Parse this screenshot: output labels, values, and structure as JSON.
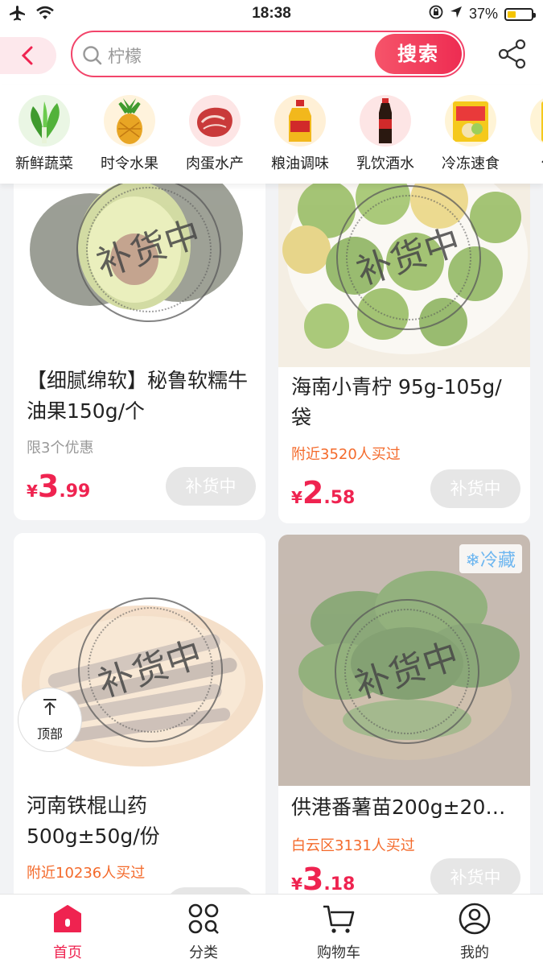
{
  "status_bar": {
    "time": "18:38",
    "battery": "37%"
  },
  "header": {
    "search_placeholder": "柠檬",
    "search_button": "搜索"
  },
  "categories": [
    {
      "label": "新鲜蔬菜",
      "icon": "vegetable-icon"
    },
    {
      "label": "时令水果",
      "icon": "pineapple-icon"
    },
    {
      "label": "肉蛋水产",
      "icon": "meat-icon"
    },
    {
      "label": "粮油调味",
      "icon": "oil-bottle-icon"
    },
    {
      "label": "乳饮酒水",
      "icon": "cola-bottle-icon"
    },
    {
      "label": "冷冻速食",
      "icon": "frozen-food-icon"
    },
    {
      "label": "休闲",
      "icon": "snack-icon"
    }
  ],
  "stamp_text": "补货中",
  "products": [
    {
      "title": "【细腻绵软】秘鲁软糯牛油果150g/个",
      "sub": "限3个优惠",
      "price_int": "3",
      "price_dec": ".99",
      "currency": "¥",
      "button": "补货中"
    },
    {
      "title": "海南小青柠 95g-105g/袋",
      "sub": "附近3520人买过",
      "price_int": "2",
      "price_dec": ".58",
      "currency": "¥",
      "button": "补货中"
    },
    {
      "title": "河南铁棍山药500g±50g/份",
      "sub": "附近10236人买过",
      "button": "补货中"
    },
    {
      "title": "供港番薯苗200g±20…",
      "sub": "白云区3131人买过",
      "price_int": "3",
      "price_dec": ".18",
      "currency": "¥",
      "button": "补货中",
      "badge": "冷藏"
    }
  ],
  "top_button": "顶部",
  "tabs": [
    {
      "label": "首页",
      "icon": "home-icon",
      "active": true
    },
    {
      "label": "分类",
      "icon": "category-icon"
    },
    {
      "label": "购物车",
      "icon": "cart-icon"
    },
    {
      "label": "我的",
      "icon": "profile-icon"
    }
  ],
  "colors": {
    "accent": "#ef2350",
    "orange": "#f46a2b",
    "cold": "#6db6f0"
  }
}
